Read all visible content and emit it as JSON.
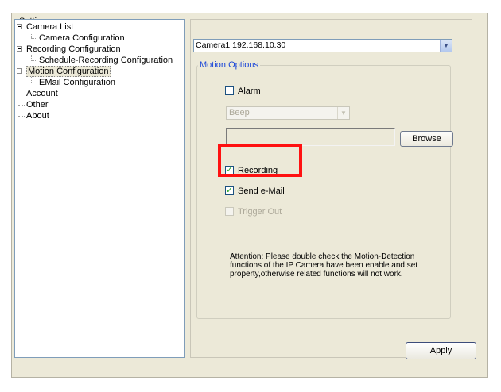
{
  "window": {
    "title": "Setting"
  },
  "tree": {
    "nodes": [
      {
        "label": "Camera List",
        "level": 0,
        "expandable": true
      },
      {
        "label": "Camera Configuration",
        "level": 1
      },
      {
        "label": "Recording Configuration",
        "level": 0,
        "expandable": true
      },
      {
        "label": "Schedule-Recording Configuration",
        "level": 1
      },
      {
        "label": "Motion Configuration",
        "level": 0,
        "expandable": true,
        "selected": true
      },
      {
        "label": "EMail Configuration",
        "level": 1
      },
      {
        "label": "Account",
        "level": 0
      },
      {
        "label": "Other",
        "level": 0
      },
      {
        "label": "About",
        "level": 0
      }
    ]
  },
  "camera_select": {
    "value": "Camera1 192.168.10.30"
  },
  "motion_options": {
    "title": "Motion Options",
    "alarm": {
      "label": "Alarm",
      "checked": false
    },
    "beep_select": {
      "value": "Beep"
    },
    "path_input": {
      "value": ""
    },
    "browse_label": "Browse",
    "recording": {
      "label": "Recording",
      "checked": true
    },
    "send_email": {
      "label": "Send e-Mail",
      "checked": true
    },
    "trigger_out": {
      "label": "Trigger Out",
      "checked": false
    },
    "attention": "Attention: Please double check the Motion-Detection functions of the IP Camera have been enable and set property,otherwise related functions will not work."
  },
  "apply_label": "Apply",
  "colors": {
    "highlight": "#ff1111",
    "group_title": "#1a46d8"
  }
}
